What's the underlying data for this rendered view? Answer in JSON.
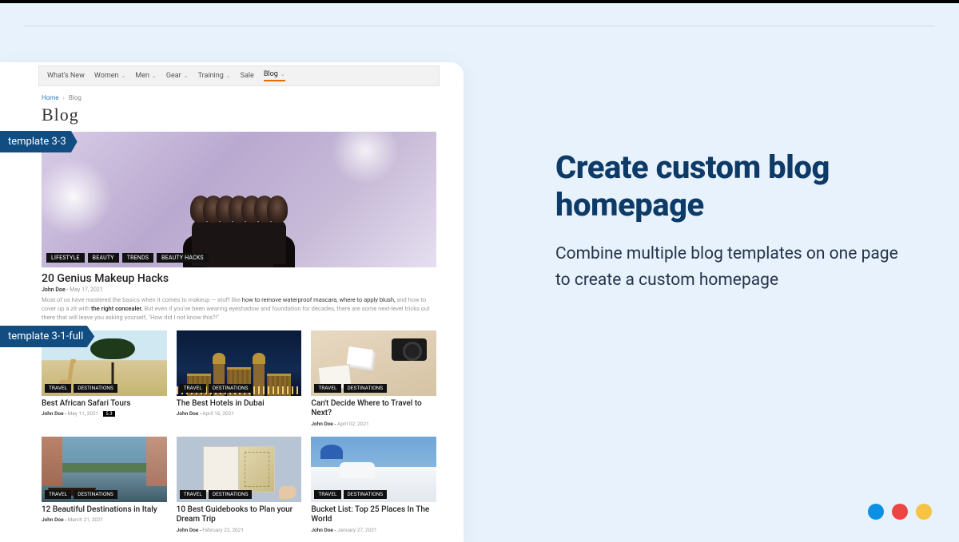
{
  "labels": {
    "template_3_3": "template 3-3",
    "template_3_1_full": "template 3-1-full"
  },
  "nav": {
    "items": [
      "What's New",
      "Women",
      "Men",
      "Gear",
      "Training",
      "Sale",
      "Blog"
    ],
    "active_index": 6
  },
  "breadcrumb": {
    "home": "Home",
    "current": "Blog"
  },
  "page_title": "Blog",
  "hero": {
    "tags": [
      "LIFESTYLE",
      "BEAUTY",
      "TRENDS",
      "BEAUTY HACKS"
    ],
    "title": "20 Genius Makeup Hacks",
    "author": "John Doe",
    "date": "May 17, 2021",
    "excerpt_pre": "Most of us have mastered the basics when it comes to makeup — stuff like ",
    "excerpt_links": "how to remove waterproof mascara, where to apply blush,",
    "excerpt_mid": " and how to cover up a zit with ",
    "excerpt_bold": "the right concealer.",
    "excerpt_post": " But even if you've been wearing eyeshadow and foundation for decades, there are some next-level tricks out there that will leave you asking yourself, \"How did I not know this?!\""
  },
  "grid": [
    {
      "tags": [
        "TRAVEL",
        "DESTINATIONS"
      ],
      "title": "Best African Safari Tours",
      "author": "John Doe",
      "date": "May 11, 2021",
      "badge": "5.3",
      "art": "safari"
    },
    {
      "tags": [
        "TRAVEL",
        "DESTINATIONS"
      ],
      "title": "The Best Hotels in Dubai",
      "author": "John Doe",
      "date": "April 16, 2021",
      "art": "dubai"
    },
    {
      "tags": [
        "TRAVEL",
        "DESTINATIONS"
      ],
      "title": "Can't Decide Where to Travel to Next?",
      "author": "John Doe",
      "date": "April 02, 2021",
      "art": "desk"
    },
    {
      "tags": [
        "TRAVEL",
        "DESTINATIONS"
      ],
      "title": "12 Beautiful Destinations in Italy",
      "author": "John Doe",
      "date": "March 21, 2021",
      "art": "venice"
    },
    {
      "tags": [
        "TRAVEL",
        "DESTINATIONS"
      ],
      "title": "10 Best Guidebooks to Plan your Dream Trip",
      "author": "John Doe",
      "date": "February 22, 2021",
      "art": "guides"
    },
    {
      "tags": [
        "TRAVEL",
        "DESTINATIONS"
      ],
      "title": "Bucket List: Top 25 Places In The World",
      "author": "John Doe",
      "date": "January 27, 2021",
      "art": "greece"
    }
  ],
  "marketing": {
    "headline": "Create custom blog homepage",
    "sub": "Combine multiple blog templates on one page to create a custom homepage"
  },
  "colors": {
    "accent": "#0d3a66",
    "label_bg": "#114d81"
  }
}
